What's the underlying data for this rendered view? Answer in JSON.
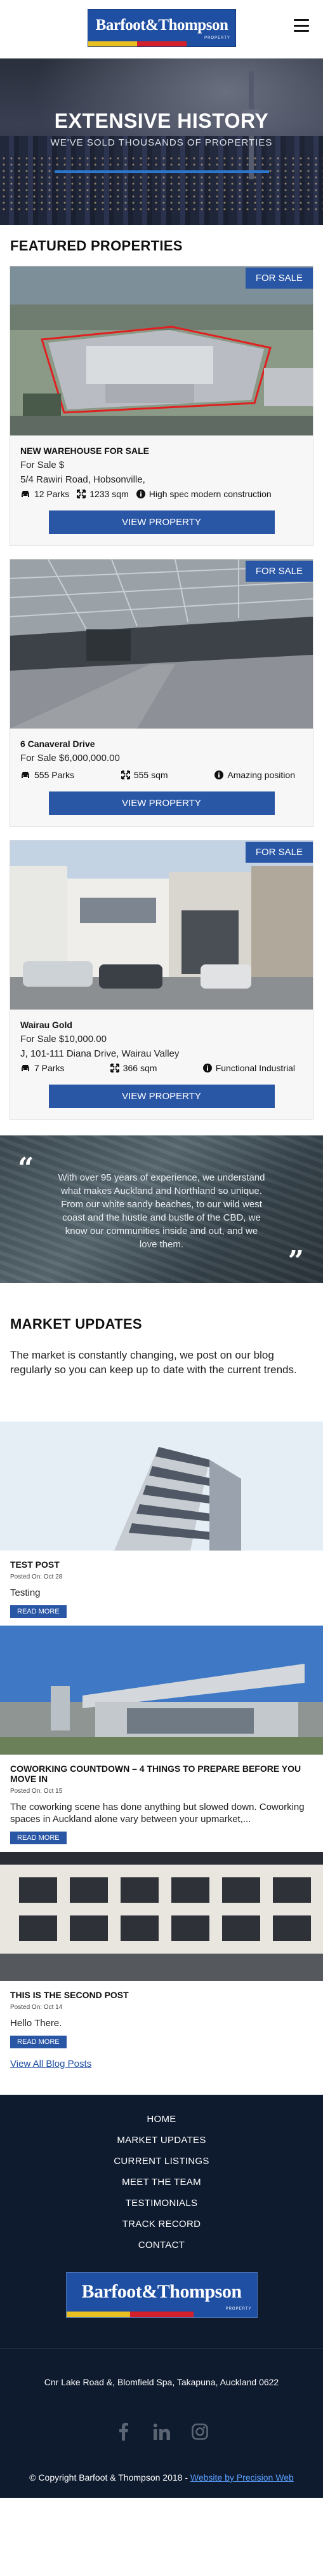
{
  "header": {
    "logo_text": "Barfoot&Thompson",
    "logo_tagline": "PROPERTY"
  },
  "hero": {
    "title": "EXTENSIVE HISTORY",
    "subtitle": "WE'VE SOLD THOUSANDS OF PROPERTIES"
  },
  "featured": {
    "title": "FEATURED PROPERTIES",
    "properties": [
      {
        "badge": "FOR SALE",
        "title": "NEW WAREHOUSE FOR SALE",
        "price": "For Sale $",
        "address": "5/4 Rawiri Road, Hobsonville,",
        "parks": "12 Parks",
        "area": "1233 sqm",
        "note": "High spec modern construction",
        "button": "VIEW PROPERTY"
      },
      {
        "badge": "FOR SALE",
        "title": "6 Canaveral Drive",
        "price": "For Sale $6,000,000.00",
        "parks": "555 Parks",
        "area": "555 sqm",
        "note": "Amazing position",
        "button": "VIEW PROPERTY"
      },
      {
        "badge": "FOR SALE",
        "title": "Wairau Gold",
        "price": "For Sale $10,000.00",
        "address": "J, 101-111 Diana Drive, Wairau Valley",
        "parks": "7 Parks",
        "area": "366 sqm",
        "note": "Functional Industrial",
        "button": "VIEW PROPERTY"
      }
    ]
  },
  "testimonial": {
    "quote": "With over 95 years of experience, we understand what makes Auckland and Northland so unique. From our white sandy beaches, to our wild west coast and the hustle and bustle of the CBD, we know our communities inside and out, and we love them."
  },
  "market": {
    "title": "MARKET UPDATES",
    "intro": "The market is constantly changing, we post on our blog regularly so you can keep up to date with the current trends.",
    "posts": [
      {
        "title": "TEST POST",
        "date": "Posted On: Oct 28",
        "excerpt": "Testing",
        "button": "READ MORE"
      },
      {
        "title": "COWORKING COUNTDOWN – 4 THINGS TO PREPARE BEFORE YOU MOVE IN",
        "date": "Posted On: Oct 15",
        "excerpt": "The coworking scene has done anything but slowed down. Coworking spaces in Auckland alone vary between your upmarket,...",
        "button": "READ MORE"
      },
      {
        "title": "THIS IS THE SECOND POST",
        "date": "Posted On: Oct 14",
        "excerpt": "Hello There.",
        "button": "READ MORE"
      }
    ],
    "view_all": "View All Blog Posts"
  },
  "footer": {
    "nav": [
      "HOME",
      "MARKET UPDATES",
      "CURRENT LISTINGS",
      "MEET THE TEAM",
      "TESTIMONIALS",
      "TRACK RECORD",
      "CONTACT"
    ],
    "address": "Cnr Lake Road &, Blomfield Spa, Takapuna, Auckland 0622",
    "copyright": "© Copyright Barfoot & Thompson 2018 -",
    "credit": "Website by Precision Web"
  },
  "colors": {
    "brand_blue": "#2a56a6",
    "footer_bg": "#0e1a2e"
  },
  "icons": {
    "menu": "hamburger-icon",
    "parks": "car-icon",
    "area": "arrows-expand-icon",
    "note": "info-icon",
    "socials": [
      "facebook-icon",
      "linkedin-icon",
      "instagram-icon"
    ]
  }
}
